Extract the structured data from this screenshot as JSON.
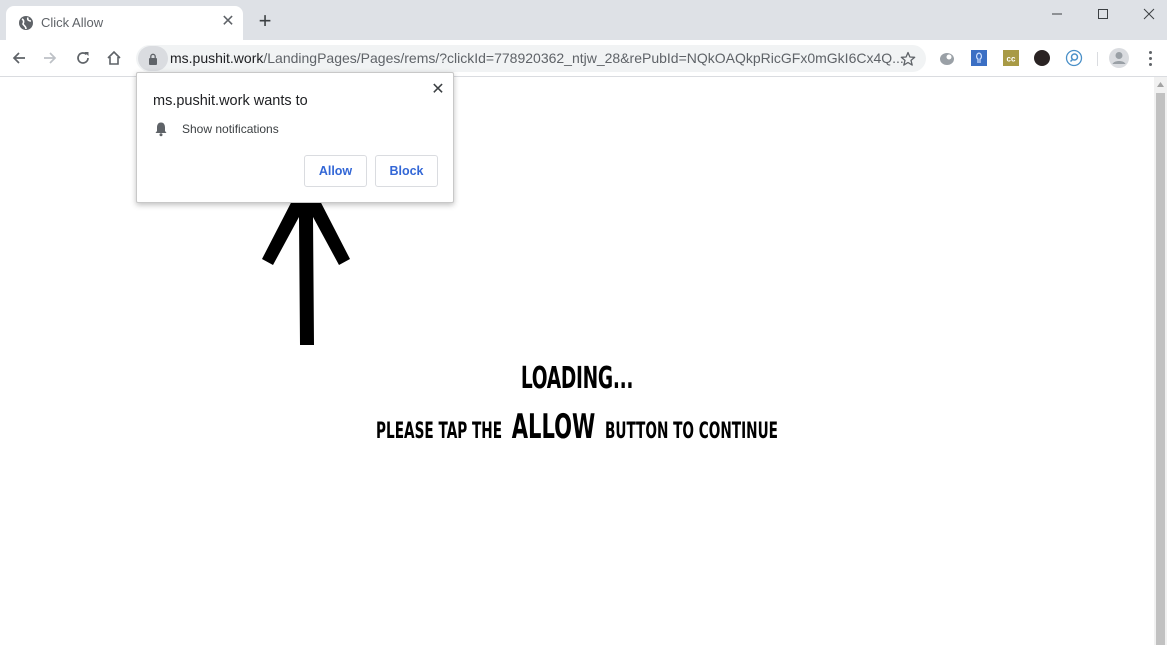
{
  "browser": {
    "tab": {
      "title": "Click Allow",
      "favicon": "globe-icon",
      "close_icon": "close-icon"
    },
    "new_tab_icon": "plus-icon",
    "window_controls": [
      "minimize-icon",
      "maximize-icon",
      "close-icon"
    ],
    "toolbar": {
      "back_icon": "arrow-left-icon",
      "forward_icon": "arrow-right-icon",
      "reload_icon": "reload-icon",
      "home_icon": "home-icon",
      "lock_icon": "lock-icon",
      "url_host": "ms.pushit.work",
      "url_path": "/LandingPages/Pages/rems/?clickId=778920362_ntjw_28&rePubId=NQkOAQkpRicGFx0mGkI6Cx4Q...",
      "bookmark_icon": "star-icon",
      "extensions": [
        "gray-disc-extension-icon",
        "blue-tree-extension-icon",
        "cc-extension-icon",
        "dark-circle-extension-icon",
        "search-lens-extension-icon"
      ],
      "profile_icon": "avatar-icon",
      "menu_icon": "kebab-menu-icon"
    }
  },
  "permission_popup": {
    "title": "ms.pushit.work wants to",
    "permission_icon": "bell-icon",
    "permission_label": "Show notifications",
    "allow_label": "Allow",
    "block_label": "Block"
  },
  "page": {
    "arrow_icon": "up-arrow-icon",
    "loading_text": "LOADING...",
    "instruction_prefix": "PLEASE TAP THE",
    "instruction_emphasis": "ALLOW",
    "instruction_suffix": "BUTTON TO CONTINUE"
  },
  "colors": {
    "tabstrip_bg": "#dee1e6",
    "omnibox_bg": "#f1f3f4",
    "button_text": "#3367d6",
    "page_text": "#000000"
  }
}
